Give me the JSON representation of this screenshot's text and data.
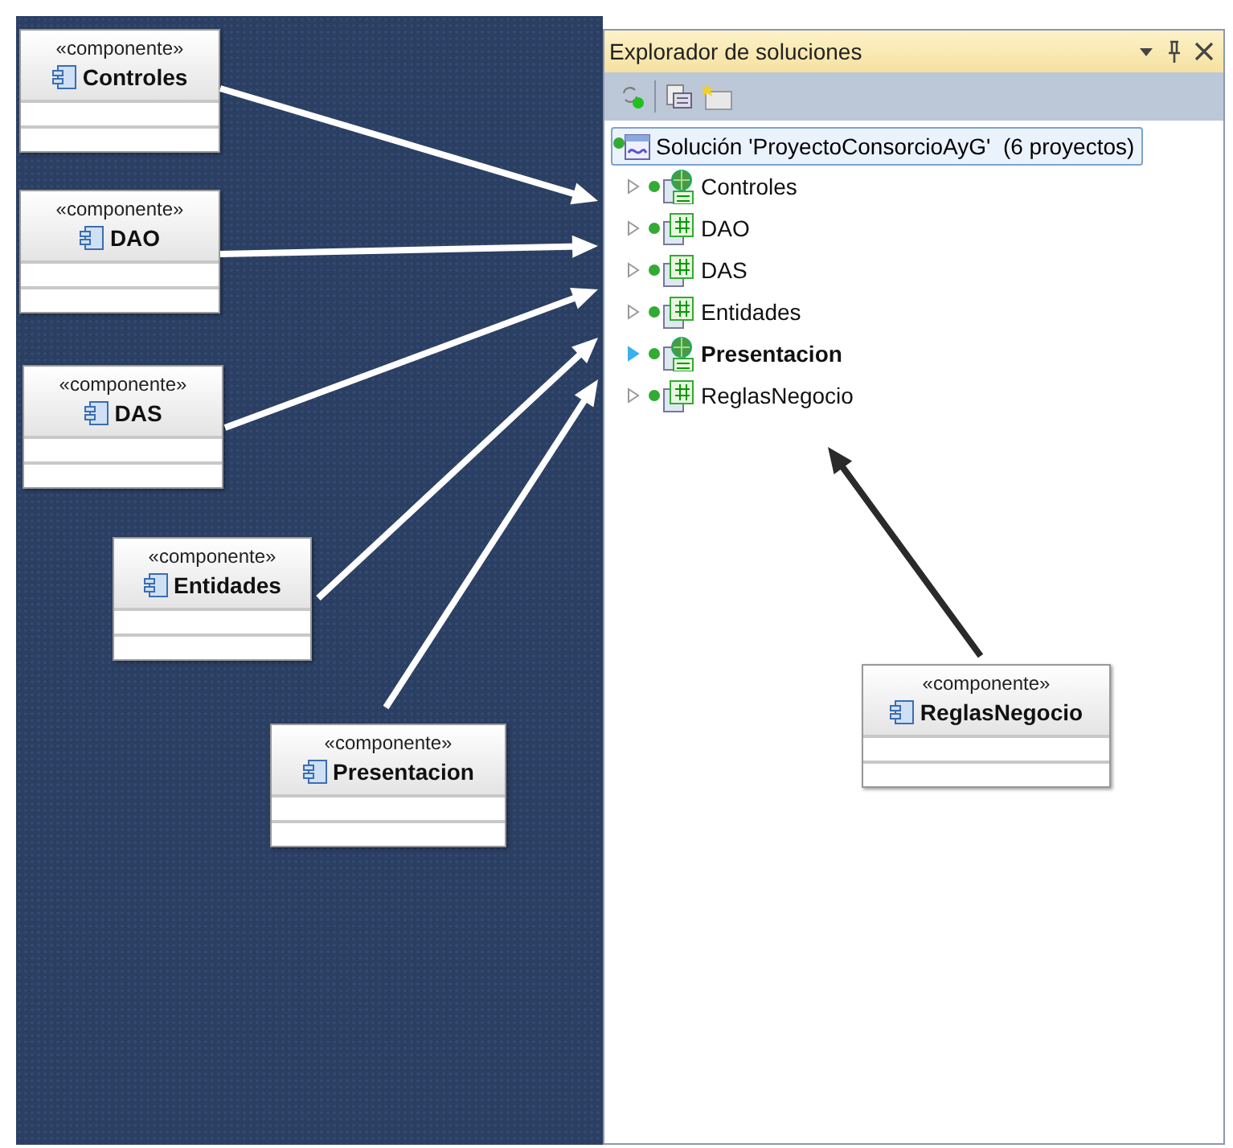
{
  "diagram": {
    "components": [
      {
        "stereotype": "«componente»",
        "name": "Controles"
      },
      {
        "stereotype": "«componente»",
        "name": "DAO"
      },
      {
        "stereotype": "«componente»",
        "name": "DAS"
      },
      {
        "stereotype": "«componente»",
        "name": "Entidades"
      },
      {
        "stereotype": "«componente»",
        "name": "Presentacion"
      },
      {
        "stereotype": "«componente»",
        "name": "ReglasNegocio"
      }
    ]
  },
  "solution_explorer": {
    "title": "Explorador de soluciones",
    "solution": {
      "label": "Solución 'ProyectoConsorcioAyG'  (6 proyectos)",
      "selected": true
    },
    "projects": [
      {
        "label": "Controles",
        "kind": "web",
        "startup": false,
        "hovered": false
      },
      {
        "label": "DAO",
        "kind": "library",
        "startup": false,
        "hovered": false
      },
      {
        "label": "DAS",
        "kind": "library",
        "startup": false,
        "hovered": false
      },
      {
        "label": "Entidades",
        "kind": "library",
        "startup": false,
        "hovered": false
      },
      {
        "label": "Presentacion",
        "kind": "web",
        "startup": true,
        "hovered": true
      },
      {
        "label": "ReglasNegocio",
        "kind": "library",
        "startup": false,
        "hovered": false
      }
    ]
  }
}
